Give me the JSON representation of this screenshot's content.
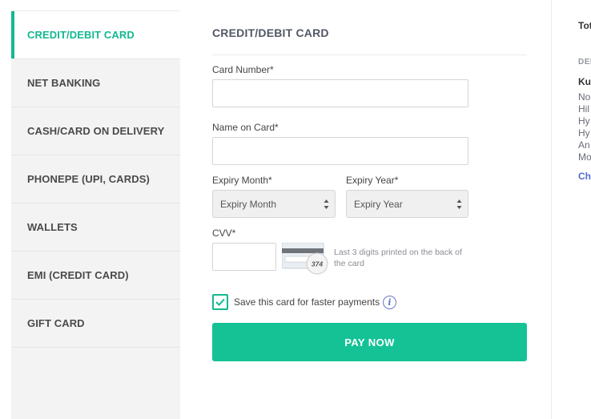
{
  "sidebar": {
    "items": [
      {
        "label": "CREDIT/DEBIT CARD"
      },
      {
        "label": "NET BANKING"
      },
      {
        "label": "CASH/CARD ON DELIVERY"
      },
      {
        "label": "PHONEPE (UPI, CARDS)"
      },
      {
        "label": "WALLETS"
      },
      {
        "label": "EMI (CREDIT CARD)"
      },
      {
        "label": "GIFT CARD"
      }
    ],
    "active_index": 0
  },
  "form": {
    "title": "CREDIT/DEBIT CARD",
    "card_number_label": "Card Number*",
    "card_number_value": "",
    "name_label": "Name on Card*",
    "name_value": "",
    "expiry_month_label": "Expiry Month*",
    "expiry_month_value": "Expiry Month",
    "expiry_year_label": "Expiry Year*",
    "expiry_year_value": "Expiry Year",
    "cvv_label": "CVV*",
    "cvv_value": "",
    "card_image_number": "374",
    "cvv_hint": "Last 3 digits printed on the back of the card",
    "save_card_label": "Save this card for faster payments",
    "save_card_checked": true,
    "pay_button": "PAY NOW"
  },
  "right_panel": {
    "total_label": "Tot",
    "deliver_label": "DEL",
    "name": "Kul",
    "address_lines": [
      "No",
      "Hil",
      "Hy",
      "Hy",
      "An",
      "Mo"
    ],
    "change_label": "Cha"
  },
  "colors": {
    "accent": "#14b890",
    "button": "#14c296",
    "link": "#526cd0"
  }
}
